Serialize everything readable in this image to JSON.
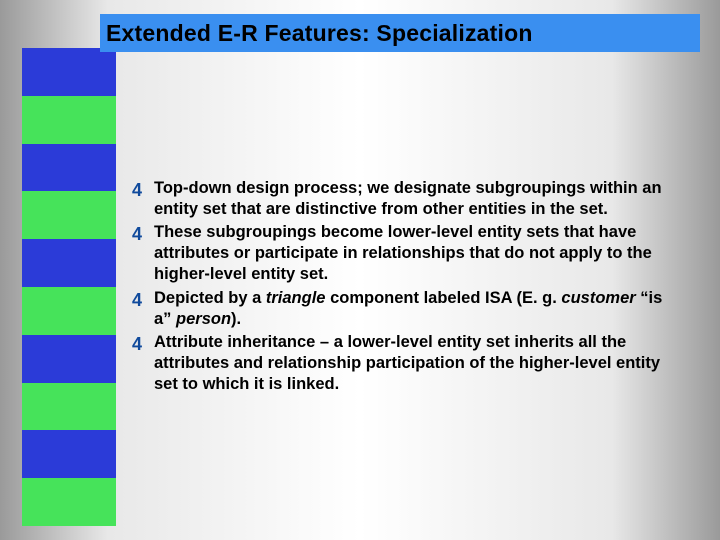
{
  "slide": {
    "title": "Extended E-R Features: Specialization",
    "bullets": [
      {
        "marker": "4",
        "html": "Top-down design process; we designate subgroupings within an entity set that are distinctive from other entities in the set."
      },
      {
        "marker": "4",
        "html": "These subgroupings become lower-level entity sets that have attributes or participate in relationships that do not apply to the higher-level entity set."
      },
      {
        "marker": "4",
        "html": "Depicted by a <em>triangle</em> component labeled ISA (E. g. <em>customer</em> “is a” <em>person</em>)."
      },
      {
        "marker": "4",
        "html": "Attribute inheritance – a lower-level entity set inherits all the attributes and relationship participation of the higher-level entity set to which it is linked."
      }
    ]
  }
}
